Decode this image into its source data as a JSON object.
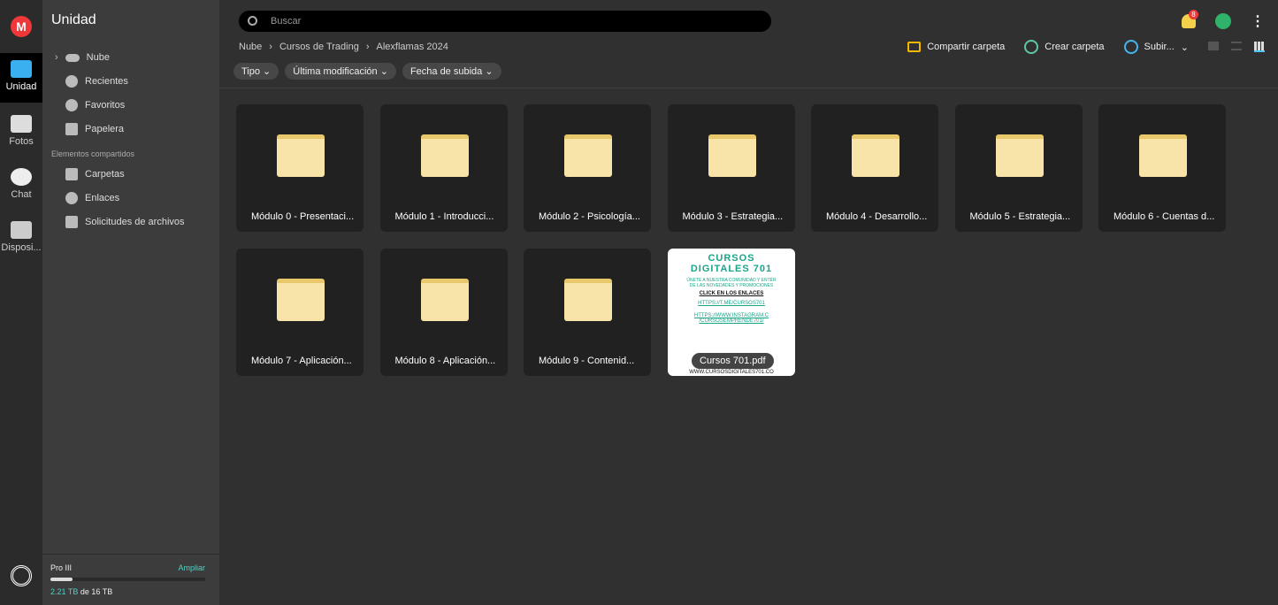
{
  "rail": {
    "items": [
      {
        "label": "Unidad",
        "active": true
      },
      {
        "label": "Fotos"
      },
      {
        "label": "Chat"
      },
      {
        "label": "Disposi..."
      }
    ]
  },
  "sidebar": {
    "title": "Unidad",
    "items": [
      "Nube",
      "Recientes",
      "Favoritos",
      "Papelera"
    ],
    "shared_heading": "Elementos compartidos",
    "shared_items": [
      "Carpetas",
      "Enlaces",
      "Solicitudes de archivos"
    ],
    "storage": {
      "plan": "Pro III",
      "upgrade": "Ampliar",
      "used": "2.21 TB",
      "of": "de 16 TB",
      "fraction": 0.14
    }
  },
  "search": {
    "placeholder": "Buscar"
  },
  "notifications": {
    "count": "8"
  },
  "breadcrumb": [
    "Nube",
    "Cursos de Trading",
    "Alexflamas 2024"
  ],
  "actions": {
    "share": "Compartir carpeta",
    "create": "Crear carpeta",
    "upload": "Subir..."
  },
  "filters": [
    "Tipo",
    "Última modificación",
    "Fecha de subida"
  ],
  "items": [
    "Módulo 0 - Presentaci...",
    "Módulo 1 - Introducci...",
    "Módulo 2 - Psicología...",
    "Módulo 3 - Estrategia...",
    "Módulo 4 - Desarrollo...",
    "Módulo 5 - Estrategia...",
    "Módulo 6 - Cuentas d...",
    "Módulo 7 - Aplicación...",
    "Módulo 8 - Aplicación...",
    "Módulo 9 - Contenid..."
  ],
  "pdf": {
    "name": "Cursos 701.pdf",
    "title1": "CURSOS",
    "title2": "DIGITALES 701",
    "line1": "ÚNETE A NUESTRA COMUNIDAD Y ENTÉR",
    "line2": "DE LAS NOVEDADES Y PROMOCIONES",
    "cta": "CLICK EN LOS ENLACES",
    "link1": "HTTPS://T.ME/CURSOS701",
    "link2a": "HTTPS://WWW.INSTAGRAM.C",
    "link2b": "/CURSOSEMPRENDE701/",
    "footer": "WWW.CURSOSDIGITALES701.CO"
  }
}
